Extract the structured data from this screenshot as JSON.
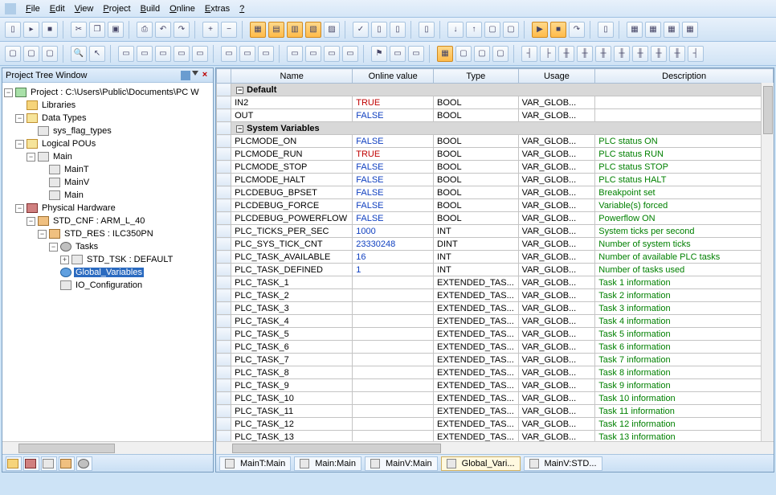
{
  "menubar": [
    "File",
    "Edit",
    "View",
    "Project",
    "Build",
    "Online",
    "Extras",
    "?"
  ],
  "tree": {
    "title": "Project Tree Window",
    "root": "Project : C:\\Users\\Public\\Documents\\PC W",
    "nodes": [
      {
        "indent": 1,
        "toggle": "",
        "icon": "i-folder",
        "label": "Libraries"
      },
      {
        "indent": 1,
        "toggle": "-",
        "icon": "i-folderopen",
        "label": "Data Types"
      },
      {
        "indent": 2,
        "toggle": "",
        "icon": "i-file",
        "label": "sys_flag_types"
      },
      {
        "indent": 1,
        "toggle": "-",
        "icon": "i-folderopen",
        "label": "Logical POUs"
      },
      {
        "indent": 2,
        "toggle": "-",
        "icon": "i-file",
        "label": "Main"
      },
      {
        "indent": 3,
        "toggle": "",
        "icon": "i-file",
        "label": "MainT"
      },
      {
        "indent": 3,
        "toggle": "",
        "icon": "i-file",
        "label": "MainV"
      },
      {
        "indent": 3,
        "toggle": "",
        "icon": "i-file",
        "label": "Main"
      },
      {
        "indent": 1,
        "toggle": "-",
        "icon": "i-hw",
        "label": "Physical Hardware"
      },
      {
        "indent": 2,
        "toggle": "-",
        "icon": "i-cfg",
        "label": "STD_CNF : ARM_L_40"
      },
      {
        "indent": 3,
        "toggle": "-",
        "icon": "i-cfg",
        "label": "STD_RES : ILC350PN"
      },
      {
        "indent": 4,
        "toggle": "-",
        "icon": "i-gear",
        "label": "Tasks"
      },
      {
        "indent": 5,
        "toggle": "+",
        "icon": "i-file",
        "label": "STD_TSK : DEFAULT"
      },
      {
        "indent": 4,
        "toggle": "",
        "icon": "i-globe",
        "label": "Global_Variables",
        "selected": true
      },
      {
        "indent": 4,
        "toggle": "",
        "icon": "i-file",
        "label": "IO_Configuration"
      }
    ]
  },
  "grid": {
    "columns": [
      "",
      "Name",
      "Online value",
      "Type",
      "Usage",
      "Description"
    ],
    "groups": [
      {
        "title": "Default",
        "rows": [
          {
            "name": "IN2",
            "value": "TRUE",
            "vclass": "v-true",
            "type": "BOOL",
            "usage": "VAR_GLOB...",
            "desc": ""
          },
          {
            "name": "OUT",
            "value": "FALSE",
            "vclass": "v-false",
            "type": "BOOL",
            "usage": "VAR_GLOB...",
            "desc": ""
          }
        ]
      },
      {
        "title": "System Variables",
        "rows": [
          {
            "name": "PLCMODE_ON",
            "value": "FALSE",
            "vclass": "v-false",
            "type": "BOOL",
            "usage": "VAR_GLOB...",
            "desc": "PLC status ON"
          },
          {
            "name": "PLCMODE_RUN",
            "value": "TRUE",
            "vclass": "v-true",
            "type": "BOOL",
            "usage": "VAR_GLOB...",
            "desc": "PLC status RUN"
          },
          {
            "name": "PLCMODE_STOP",
            "value": "FALSE",
            "vclass": "v-false",
            "type": "BOOL",
            "usage": "VAR_GLOB...",
            "desc": "PLC status STOP"
          },
          {
            "name": "PLCMODE_HALT",
            "value": "FALSE",
            "vclass": "v-false",
            "type": "BOOL",
            "usage": "VAR_GLOB...",
            "desc": "PLC status HALT"
          },
          {
            "name": "PLCDEBUG_BPSET",
            "value": "FALSE",
            "vclass": "v-false",
            "type": "BOOL",
            "usage": "VAR_GLOB...",
            "desc": "Breakpoint set"
          },
          {
            "name": "PLCDEBUG_FORCE",
            "value": "FALSE",
            "vclass": "v-false",
            "type": "BOOL",
            "usage": "VAR_GLOB...",
            "desc": "Variable(s) forced"
          },
          {
            "name": "PLCDEBUG_POWERFLOW",
            "value": "FALSE",
            "vclass": "v-false",
            "type": "BOOL",
            "usage": "VAR_GLOB...",
            "desc": "Powerflow ON"
          },
          {
            "name": "PLC_TICKS_PER_SEC",
            "value": "1000",
            "vclass": "v-num",
            "type": "INT",
            "usage": "VAR_GLOB...",
            "desc": "System ticks per second"
          },
          {
            "name": "PLC_SYS_TICK_CNT",
            "value": "23330248",
            "vclass": "v-num",
            "type": "DINT",
            "usage": "VAR_GLOB...",
            "desc": "Number of system ticks"
          },
          {
            "name": "PLC_TASK_AVAILABLE",
            "value": "16",
            "vclass": "v-num",
            "type": "INT",
            "usage": "VAR_GLOB...",
            "desc": "Number of available PLC tasks"
          },
          {
            "name": "PLC_TASK_DEFINED",
            "value": "1",
            "vclass": "v-num",
            "type": "INT",
            "usage": "VAR_GLOB...",
            "desc": "Number of tasks used"
          },
          {
            "name": "PLC_TASK_1",
            "value": "",
            "vclass": "",
            "type": "EXTENDED_TAS...",
            "usage": "VAR_GLOB...",
            "desc": "Task 1 information"
          },
          {
            "name": "PLC_TASK_2",
            "value": "",
            "vclass": "",
            "type": "EXTENDED_TAS...",
            "usage": "VAR_GLOB...",
            "desc": "Task 2 information"
          },
          {
            "name": "PLC_TASK_3",
            "value": "",
            "vclass": "",
            "type": "EXTENDED_TAS...",
            "usage": "VAR_GLOB...",
            "desc": "Task 3 information"
          },
          {
            "name": "PLC_TASK_4",
            "value": "",
            "vclass": "",
            "type": "EXTENDED_TAS...",
            "usage": "VAR_GLOB...",
            "desc": "Task 4 information"
          },
          {
            "name": "PLC_TASK_5",
            "value": "",
            "vclass": "",
            "type": "EXTENDED_TAS...",
            "usage": "VAR_GLOB...",
            "desc": "Task 5 information"
          },
          {
            "name": "PLC_TASK_6",
            "value": "",
            "vclass": "",
            "type": "EXTENDED_TAS...",
            "usage": "VAR_GLOB...",
            "desc": "Task 6 information"
          },
          {
            "name": "PLC_TASK_7",
            "value": "",
            "vclass": "",
            "type": "EXTENDED_TAS...",
            "usage": "VAR_GLOB...",
            "desc": "Task 7 information"
          },
          {
            "name": "PLC_TASK_8",
            "value": "",
            "vclass": "",
            "type": "EXTENDED_TAS...",
            "usage": "VAR_GLOB...",
            "desc": "Task 8 information"
          },
          {
            "name": "PLC_TASK_9",
            "value": "",
            "vclass": "",
            "type": "EXTENDED_TAS...",
            "usage": "VAR_GLOB...",
            "desc": "Task 9 information"
          },
          {
            "name": "PLC_TASK_10",
            "value": "",
            "vclass": "",
            "type": "EXTENDED_TAS...",
            "usage": "VAR_GLOB...",
            "desc": "Task 10 information"
          },
          {
            "name": "PLC_TASK_11",
            "value": "",
            "vclass": "",
            "type": "EXTENDED_TAS...",
            "usage": "VAR_GLOB...",
            "desc": "Task 11 information"
          },
          {
            "name": "PLC_TASK_12",
            "value": "",
            "vclass": "",
            "type": "EXTENDED_TAS...",
            "usage": "VAR_GLOB...",
            "desc": "Task 12 information"
          },
          {
            "name": "PLC_TASK_13",
            "value": "",
            "vclass": "",
            "type": "EXTENDED_TAS...",
            "usage": "VAR_GLOB...",
            "desc": "Task 13 information"
          }
        ]
      }
    ]
  },
  "doctabs": [
    {
      "label": "MainT:Main",
      "active": false
    },
    {
      "label": "Main:Main",
      "active": false
    },
    {
      "label": "MainV:Main",
      "active": false
    },
    {
      "label": "Global_Vari...",
      "active": true
    },
    {
      "label": "MainV:STD...",
      "active": false
    }
  ]
}
